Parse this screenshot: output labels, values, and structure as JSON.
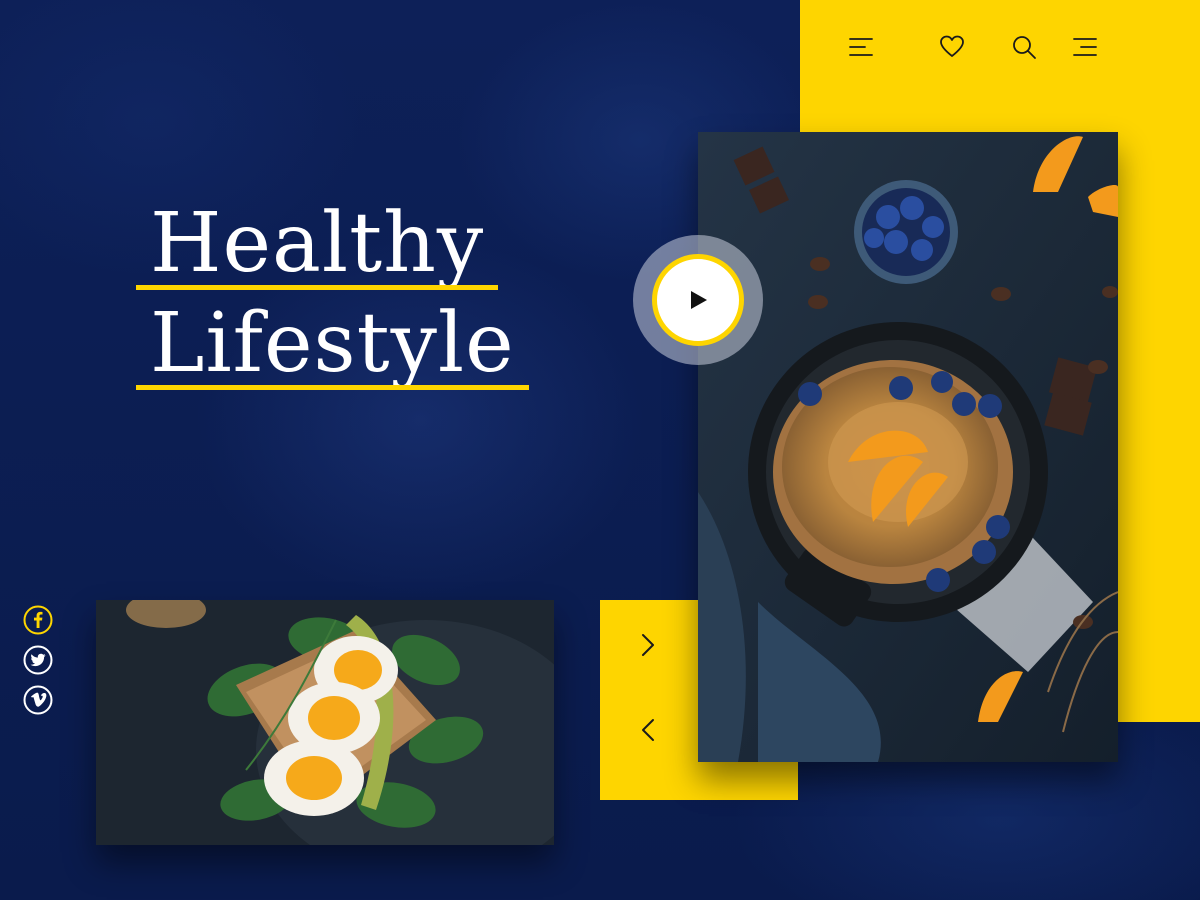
{
  "hero": {
    "title_line1": "Healthy",
    "title_line2": "Lifestyle"
  },
  "header": {
    "icons": [
      "menu-icon",
      "heart-icon",
      "search-icon",
      "menu-right-icon"
    ]
  },
  "slider": {
    "icons": [
      "chevron-right-icon",
      "chevron-left-icon"
    ]
  },
  "social": {
    "icons": [
      "facebook-icon",
      "twitter-icon",
      "vimeo-icon"
    ]
  },
  "media": {
    "play_icon": "play-icon",
    "main_photo": "pancake-photo",
    "secondary_photo": "egg-toast-photo"
  },
  "colors": {
    "accent": "#fed500",
    "background": "#0c1f55",
    "text": "#ffffff"
  }
}
